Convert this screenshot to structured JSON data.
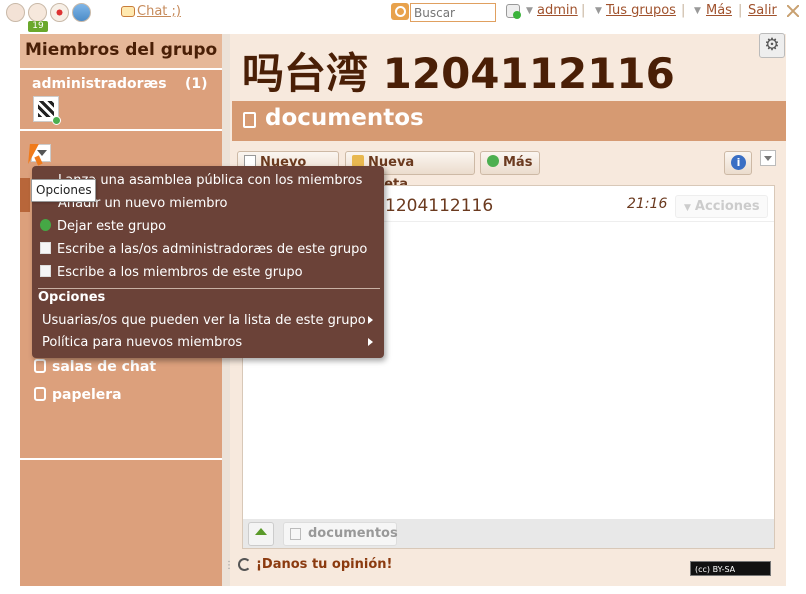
{
  "topbar": {
    "notification_count": "19",
    "chat_label": "Chat ;)",
    "search_placeholder": "Buscar",
    "user_label": "admin",
    "groups_label": "Tus grupos",
    "more_label": "Más",
    "logout_label": "Salir",
    "separator": "|"
  },
  "sidebar": {
    "title": "Miembros del grupo",
    "admins_label": "administradoræs",
    "admins_count": "(1)",
    "nav": [
      {
        "label": "salas de chat"
      },
      {
        "label": "papelera"
      }
    ]
  },
  "main": {
    "title": "吗台湾 1204112116",
    "section_title": "documentos",
    "toolbar": {
      "new_doc": "Nuevo doc",
      "new_folder": "Nueva carpeta",
      "more": "Más"
    },
    "documents": [
      {
        "name": "1204112116",
        "time": "21:16",
        "action": "Acciones"
      }
    ],
    "footer_crumb": "documentos",
    "feedback": "¡Danos tu opinión!",
    "license": "(cc) BY-SA"
  },
  "popup_menu": {
    "tooltip": "Opciones",
    "items": [
      {
        "label": "Lanza una asamblea pública con los miembros"
      },
      {
        "label": "Añadir un nuevo miembro"
      },
      {
        "label": "Dejar este grupo"
      },
      {
        "label": "Escribe a las/os administradoræs de este grupo"
      },
      {
        "label": "Escribe a los miembros de este grupo"
      }
    ],
    "options_heading": "Opciones",
    "submenus": [
      {
        "label": "Usuarias/os que pueden ver la lista de este grupo"
      },
      {
        "label": "Política para nuevos miembros"
      }
    ]
  }
}
